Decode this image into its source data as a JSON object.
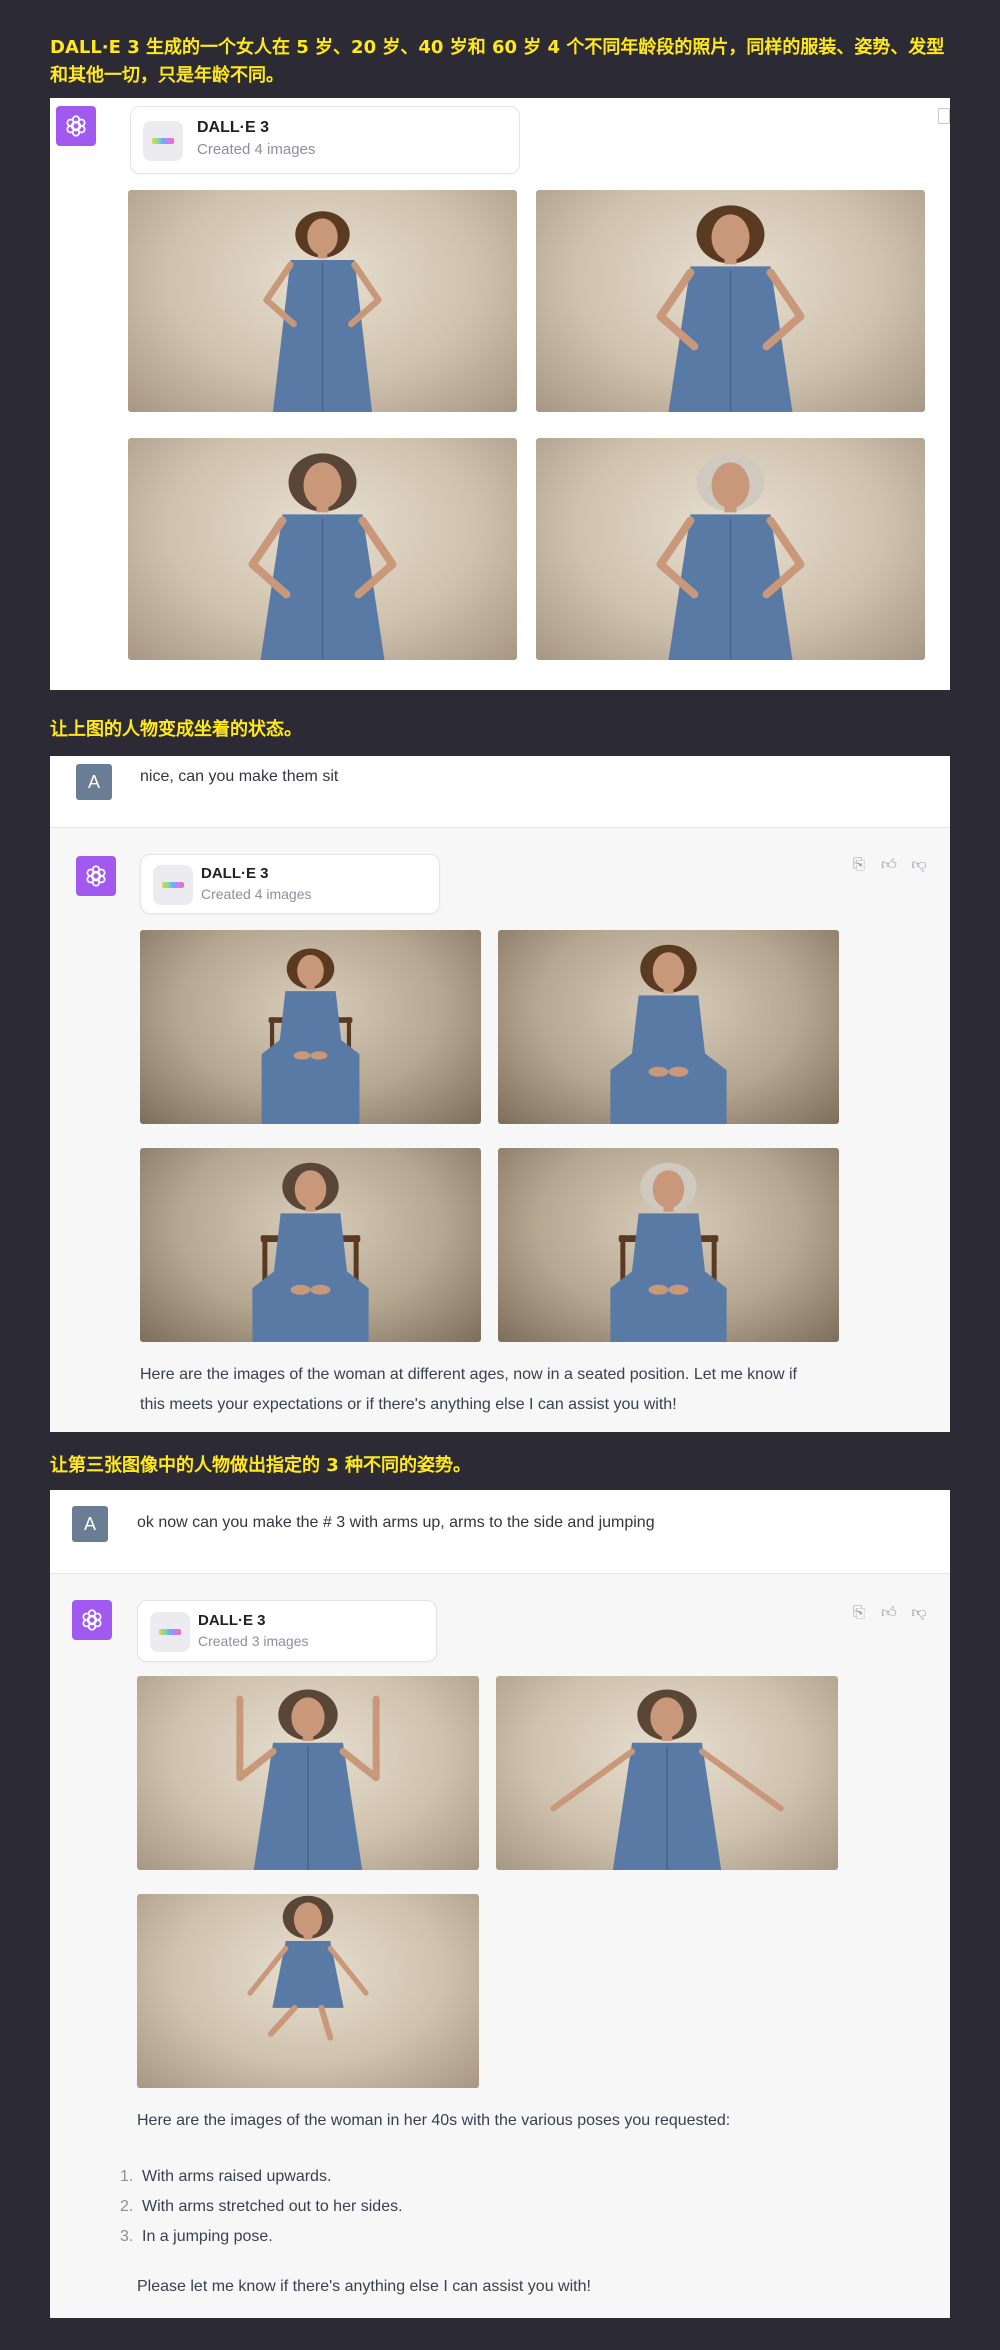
{
  "captions": {
    "c1_line1": "DALL·E 3 生成的一个女人在 5 岁、20 岁、40 岁和 60 岁 4 个不同年龄段的照片，同样的服装、姿势、发型",
    "c1_line2": "和其他一切，只是年龄不同。",
    "c2": "让上图的人物变成坐着的状态。",
    "c3": "让第三张图像中的人物做出指定的 3 种不同的姿势。"
  },
  "user_avatar_letter": "A",
  "tool": {
    "name": "DALL·E 3",
    "created_4": "Created 4 images",
    "created_3": "Created 3 images"
  },
  "panel1": {
    "images": [
      {
        "subject": "girl age 5, hands on hips, blue dress"
      },
      {
        "subject": "woman age 20, hands on hips, blue dress"
      },
      {
        "subject": "woman age 40, hands on hips, blue dress"
      },
      {
        "subject": "woman age 60, hands on hips, blue dress"
      }
    ]
  },
  "panel2": {
    "user_message": "nice, can you make them sit",
    "reply_line1": "Here are the images of the woman at different ages, now in a seated position. Let me know if",
    "reply_line2": "this meets your expectations or if there's anything else I can assist you with!"
  },
  "panel3": {
    "user_message": "ok now can you make the # 3 with arms up, arms to the side and jumping",
    "reply_intro": "Here are the images of the woman in her 40s with the various poses you requested:",
    "list": [
      {
        "num": "1.",
        "text": "With arms raised upwards."
      },
      {
        "num": "2.",
        "text": "With arms stretched out to her sides."
      },
      {
        "num": "3.",
        "text": "In a jumping pose."
      }
    ],
    "reply_outro": "Please let me know if there's anything else I can assist you with!"
  },
  "icons": {
    "copy": "clipboard-icon",
    "like": "thumbs-up-icon",
    "dislike": "thumbs-down-icon",
    "logo": "openai-logo-icon"
  },
  "colors": {
    "background": "#2b2a35",
    "caption": "#ffe81c",
    "gpt_logo": "#a259f0",
    "user_avatar": "#6b7d94",
    "dress": "#5a7aa6"
  }
}
